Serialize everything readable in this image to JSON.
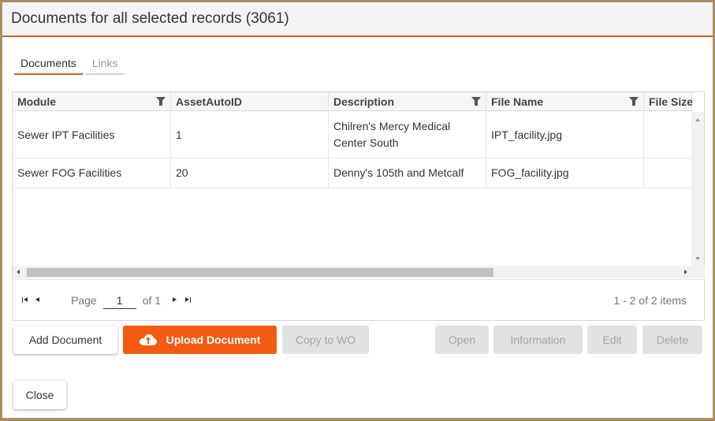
{
  "dialog": {
    "title": "Documents for all selected records (3061)"
  },
  "tabs": [
    {
      "label": "Documents",
      "active": true
    },
    {
      "label": "Links",
      "active": false
    }
  ],
  "grid": {
    "columns": [
      {
        "label": "Module",
        "filter": true
      },
      {
        "label": "AssetAutoID",
        "filter": false
      },
      {
        "label": "Description",
        "filter": true
      },
      {
        "label": "File Name",
        "filter": true
      },
      {
        "label": "File Size",
        "filter": false
      }
    ],
    "rows": [
      {
        "module": "Sewer IPT Facilities",
        "asset_auto_id": "1",
        "description": "Chilren's Mercy Medical Center South",
        "file_name": "IPT_facility.jpg",
        "file_size": ""
      },
      {
        "module": "Sewer FOG Facilities",
        "asset_auto_id": "20",
        "description": "Denny's 105th and Metcalf",
        "file_name": "FOG_facility.jpg",
        "file_size": ""
      }
    ]
  },
  "pager": {
    "page_label": "Page",
    "page_value": "1",
    "of_label": "of 1",
    "summary": "1 - 2 of 2 items"
  },
  "actions": {
    "add_document": "Add Document",
    "upload_document": "Upload Document",
    "copy_to_wo": "Copy to WO",
    "open": "Open",
    "information": "Information",
    "edit": "Edit",
    "delete": "Delete",
    "close": "Close"
  },
  "icons": {
    "filter": "filter-icon",
    "upload": "cloud-upload-icon"
  },
  "colors": {
    "accent": "#e35b1c",
    "primary_button": "#f35a14",
    "disabled_button": "#e2e2e2"
  }
}
